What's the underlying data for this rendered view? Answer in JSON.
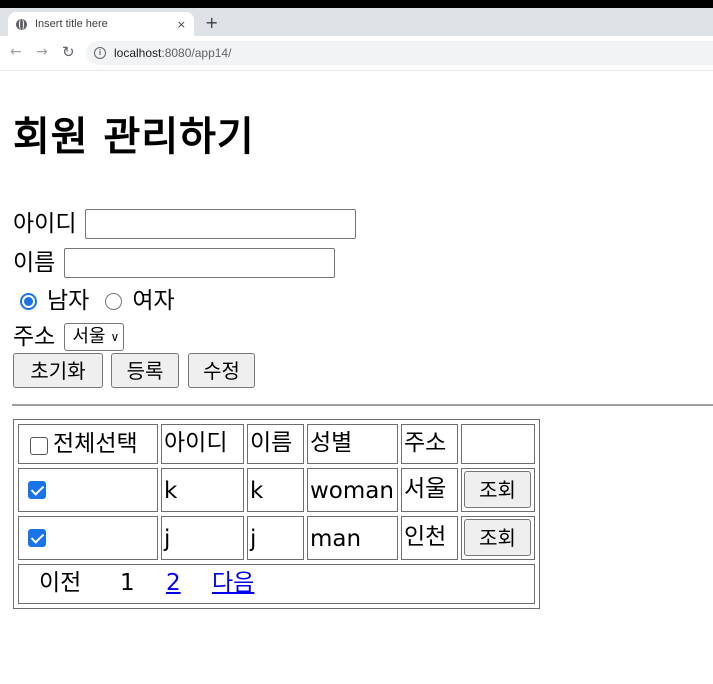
{
  "browser": {
    "tab_title": "Insert title here",
    "tab_close": "×",
    "new_tab": "+",
    "url_host": "localhost",
    "url_path": ":8080/app14/"
  },
  "page": {
    "title": "회원 관리하기",
    "form": {
      "id_label": "아이디",
      "id_value": "",
      "name_label": "이름",
      "name_value": "",
      "gender_male": "남자",
      "gender_female": "여자",
      "gender_selected": "남자",
      "address_label": "주소",
      "address_selected": "서울"
    },
    "buttons": {
      "reset": "초기화",
      "register": "등록",
      "modify": "수정"
    },
    "table": {
      "headers": [
        "전체선택",
        "아이디",
        "이름",
        "성별",
        "주소",
        ""
      ],
      "select_all_checked": false,
      "rows": [
        {
          "checked": true,
          "id": "k",
          "name": "k",
          "gender": "woman",
          "address": "서울",
          "action": "조회"
        },
        {
          "checked": true,
          "id": "j",
          "name": "j",
          "gender": "man",
          "address": "인천",
          "action": "조회"
        }
      ],
      "pager": {
        "prev": "이전",
        "current": "1",
        "next_page": "2",
        "next": "다음"
      }
    }
  },
  "colors": {
    "accent": "#1a73e8",
    "link": "#0000ee"
  }
}
